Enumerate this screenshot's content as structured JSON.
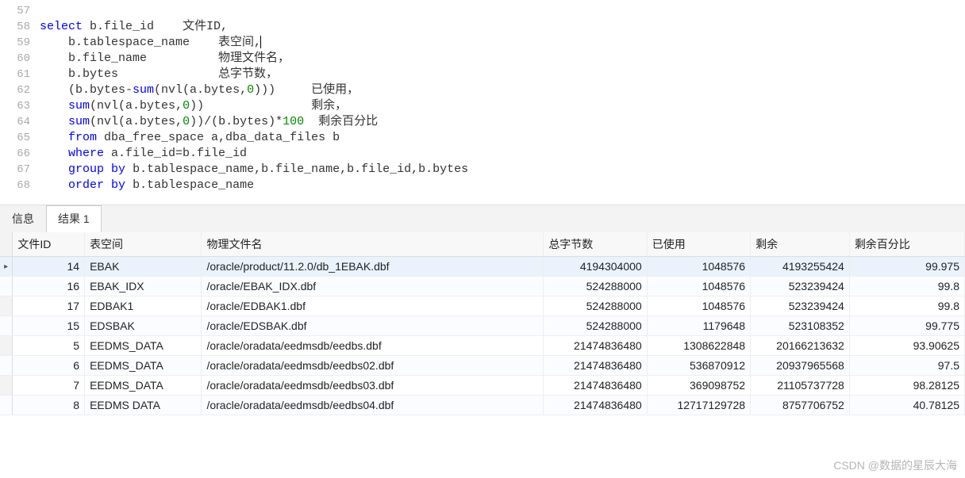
{
  "editor": {
    "lines": [
      {
        "n": "57",
        "html": ""
      },
      {
        "n": "58",
        "html": "<span class='kw'>select</span> b.file_id    文件ID,"
      },
      {
        "n": "59",
        "html": "    b.tablespace_name    表空间,<span class='caret'></span>"
      },
      {
        "n": "60",
        "html": "    b.file_name          物理文件名，"
      },
      {
        "n": "61",
        "html": "    b.bytes              总字节数，"
      },
      {
        "n": "62",
        "html": "    (b.bytes-<span class='kw'>sum</span>(nvl(a.bytes,<span class='num'>0</span>)))     已使用，"
      },
      {
        "n": "63",
        "html": "    <span class='kw'>sum</span>(nvl(a.bytes,<span class='num'>0</span>))               剩余，"
      },
      {
        "n": "64",
        "html": "    <span class='kw'>sum</span>(nvl(a.bytes,<span class='num'>0</span>))/(b.bytes)*<span class='num'>100</span>  剩余百分比"
      },
      {
        "n": "65",
        "html": "    <span class='kw'>from</span> dba_free_space a,dba_data_files b"
      },
      {
        "n": "66",
        "html": "    <span class='kw'>where</span> a.file_id=b.file_id"
      },
      {
        "n": "67",
        "html": "    <span class='kw'>group</span> <span class='kw'>by</span> b.tablespace_name,b.file_name,b.file_id,b.bytes"
      },
      {
        "n": "68",
        "html": "    <span class='kw'>order</span> <span class='kw'>by</span> b.tablespace_name"
      }
    ]
  },
  "tabs": {
    "info_label": "信息",
    "result_label": "结果 1"
  },
  "table": {
    "headers": [
      "文件ID",
      "表空间",
      "物理文件名",
      "总字节数",
      "已使用",
      "剩余",
      "剩余百分比"
    ],
    "rows": [
      {
        "selected": true,
        "cells": [
          "14",
          "EBAK",
          "/oracle/product/11.2.0/db_1EBAK.dbf",
          "4194304000",
          "1048576",
          "4193255424",
          "99.975"
        ]
      },
      {
        "selected": false,
        "cells": [
          "16",
          "EBAK_IDX",
          "/oracle/EBAK_IDX.dbf",
          "524288000",
          "1048576",
          "523239424",
          "99.8"
        ]
      },
      {
        "selected": false,
        "cells": [
          "17",
          "EDBAK1",
          "/oracle/EDBAK1.dbf",
          "524288000",
          "1048576",
          "523239424",
          "99.8"
        ]
      },
      {
        "selected": false,
        "cells": [
          "15",
          "EDSBAK",
          "/oracle/EDSBAK.dbf",
          "524288000",
          "1179648",
          "523108352",
          "99.775"
        ]
      },
      {
        "selected": false,
        "cells": [
          "5",
          "EEDMS_DATA",
          "/oracle/oradata/eedmsdb/eedbs.dbf",
          "21474836480",
          "1308622848",
          "20166213632",
          "93.90625"
        ]
      },
      {
        "selected": false,
        "cells": [
          "6",
          "EEDMS_DATA",
          "/oracle/oradata/eedmsdb/eedbs02.dbf",
          "21474836480",
          "536870912",
          "20937965568",
          "97.5"
        ]
      },
      {
        "selected": false,
        "cells": [
          "7",
          "EEDMS_DATA",
          "/oracle/oradata/eedmsdb/eedbs03.dbf",
          "21474836480",
          "369098752",
          "21105737728",
          "98.28125"
        ]
      },
      {
        "selected": false,
        "cells": [
          "8",
          "EEDMS DATA",
          "/oracle/oradata/eedmsdb/eedbs04.dbf",
          "21474836480",
          "12717129728",
          "8757706752",
          "40.78125"
        ]
      }
    ]
  },
  "watermark": "CSDN @数据的星辰大海"
}
